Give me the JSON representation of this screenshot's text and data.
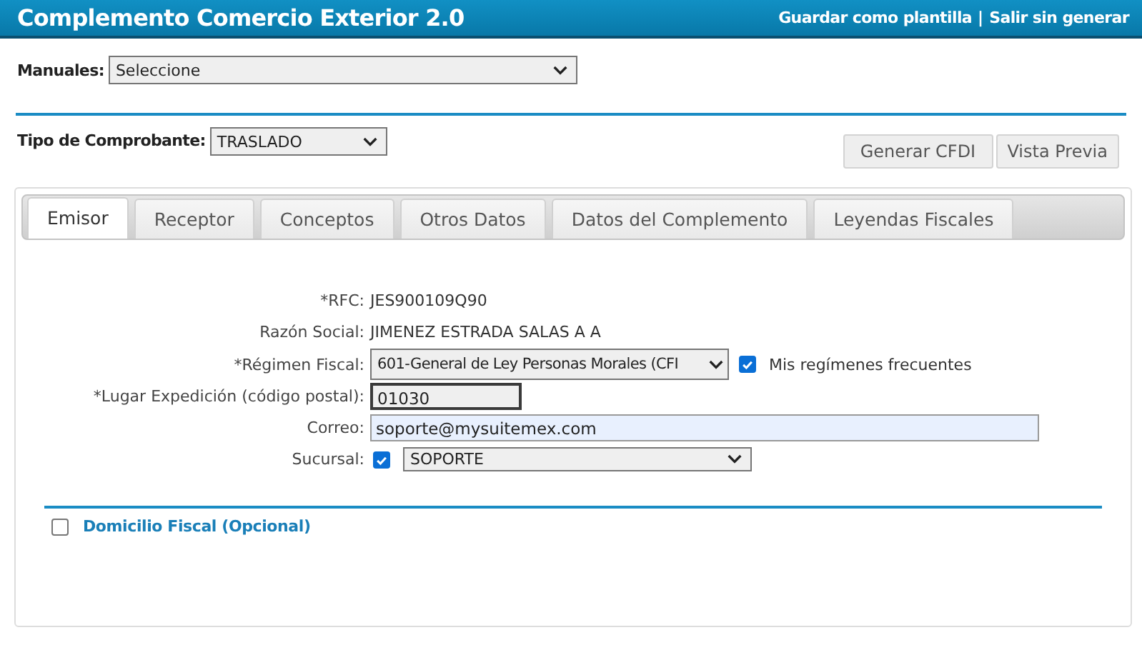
{
  "header": {
    "title": "Complemento Comercio Exterior 2.0",
    "links": [
      "Guardar como plantilla",
      "Salir sin generar"
    ],
    "separator": "|"
  },
  "manuales": {
    "label": "Manuales:",
    "value": "Seleccione"
  },
  "tipo_comprobante": {
    "label": "Tipo de Comprobante:",
    "value": "TRASLADO"
  },
  "buttons": [
    "Generar CFDI",
    "Vista Previa"
  ],
  "tabs": [
    {
      "label": "Emisor",
      "selected": true
    },
    {
      "label": "Receptor",
      "selected": false
    },
    {
      "label": "Conceptos",
      "selected": false
    },
    {
      "label": "Otros Datos",
      "selected": false
    },
    {
      "label": "Datos del Complemento",
      "selected": false
    },
    {
      "label": "Leyendas Fiscales",
      "selected": false
    }
  ],
  "form_rows": [
    {
      "kind": "text",
      "label": "*RFC:",
      "value": "JES900109Q90"
    },
    {
      "kind": "text",
      "label": "Razón Social:",
      "value": "JIMENEZ ESTRADA SALAS A A"
    },
    {
      "kind": "select",
      "label": "*Régimen Fiscal:",
      "value": "601-General de Ley Personas Morales (CFI",
      "option": {
        "label": "Mis regímenes frecuentes",
        "checked": true
      }
    },
    {
      "kind": "short_input",
      "label": "*Lugar Expedición (código postal):",
      "value": "01030"
    },
    {
      "kind": "wide_input",
      "label": "Correo:",
      "value": "soporte@mysuitemex.com"
    },
    {
      "kind": "check_select",
      "label": "Sucursal:",
      "checked": true,
      "value": "SOPORTE"
    }
  ],
  "domicilio": {
    "label": "Domicilio Fiscal (Opcional)",
    "checked": false
  }
}
